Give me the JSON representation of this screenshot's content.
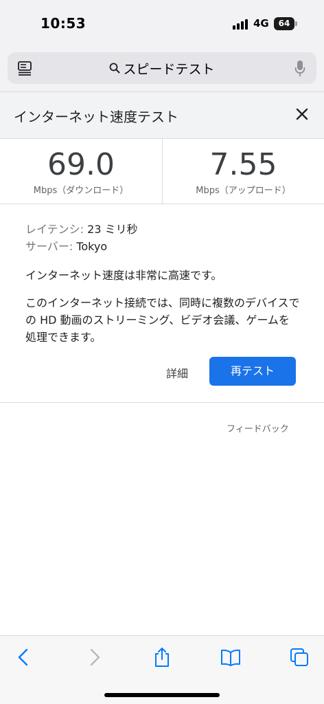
{
  "status_bar": {
    "time": "10:53",
    "network": "4G",
    "battery": "64"
  },
  "address_bar": {
    "search_text": "スピードテスト",
    "icons": [
      "reader-icon",
      "search-icon",
      "mic-icon"
    ]
  },
  "widget": {
    "title": "インターネット速度テスト",
    "close_icon": "close-icon",
    "download": {
      "value": "69.0",
      "unit": "Mbps（ダウンロード）"
    },
    "upload": {
      "value": "7.55",
      "unit": "Mbps（アップロード）"
    },
    "latency_label": "レイテンシ:",
    "latency_value": "23 ミリ秒",
    "server_label": "サーバー:",
    "server_value": "Tokyo",
    "summary": "インターネット速度は非常に高速です。",
    "detail": "このインターネット接続では、同時に複数のデバイスでの HD 動画のストリーミング、ビデオ会議、ゲームを処理できます。",
    "details_label": "詳細",
    "retest_label": "再テスト",
    "accent_color": "#1a73e8"
  },
  "feedback_label": "フィードバック",
  "toolbar": {
    "icons": [
      "back-icon",
      "forward-icon",
      "share-icon",
      "bookmarks-icon",
      "tabs-icon"
    ],
    "tint_color": "#007aff"
  }
}
